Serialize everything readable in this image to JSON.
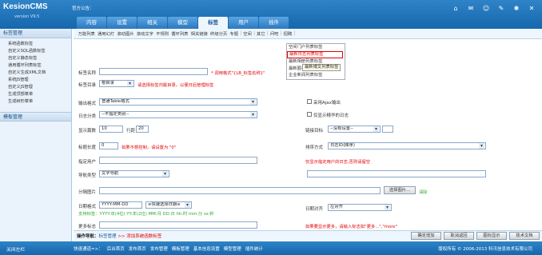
{
  "app": {
    "logo": "KesionCMS",
    "version": "version V9.5",
    "notice": "官方公告："
  },
  "tabs": [
    "内容",
    "设置",
    "相关",
    "模型",
    "标签",
    "用户",
    "插件"
  ],
  "active_tab": "标签",
  "top_icons": [
    "home-icon",
    "mail-icon",
    "user-icon",
    "tools-icon",
    "gear-icon",
    "exit-icon"
  ],
  "subbar": [
    "万能列表",
    "通用幻灯",
    "滚动图片",
    "滚动文字",
    "不规则",
    "循环列表",
    "相关链接",
    "终级分页",
    "专题",
    "│",
    "空间",
    "│",
    "其它",
    "│",
    "问吧",
    "│",
    "招聘",
    "│"
  ],
  "sidebar": {
    "head1": "标签管理",
    "items": [
      "系统函数标签",
      "自定义SQL函数标签",
      "自定义静态标签",
      "通用循环列表标签",
      "自定义生成XML文档",
      "系统JS管理",
      "自定义JS管理",
      "生成顶部菜单",
      "生成树形菜单"
    ],
    "head2": "模板管理"
  },
  "dropdown": {
    "items": [
      "空间门户列表标签",
      "最新日志列表标签",
      "最新相册列表标签",
      "最新圈子列表标签",
      "企业新闻列表标签"
    ],
    "tooltip": "最新博文列表标签"
  },
  "form": {
    "tag_name_label": "标签名称",
    "tag_name_hint": "* 调用格式\"{LB_标签名称}\"",
    "tag_dir_label": "标签目录",
    "tag_dir_value": "根目录",
    "tag_dir_hint": "请选择标签归属目录，以便日后管理标签",
    "output_label": "输出格式",
    "output_value": "普通Table格式",
    "ajax_label": "采用Ajax输出",
    "category_label": "日志分类",
    "category_value": "--不指定类别--",
    "recommend_label": "仅显示精华的日志",
    "count_label": "显示篇数",
    "count_value": "10",
    "cols_label": "行距",
    "cols_value": "20",
    "link_label": "链接目标",
    "link_value": "--没有设置--",
    "title_len_label": "标题长度",
    "title_len_value": "0",
    "title_len_hint": "如果不想控制，请设置为 \"0\"",
    "sort_label": "排序方式",
    "sort_value": "日志ID(降序)",
    "user_label": "指定用户",
    "user_hint": "仅显示指定用户的日志,否则请留空",
    "nav_label": "导航类型",
    "nav_value": "文字导航",
    "divider_label": "分隔图片",
    "select_pic": "选择图片...",
    "clear": "清除",
    "date_label": "日期格式",
    "date_value": "YYYY-MM-DD",
    "date_select": "≡快速选择日期≡",
    "date_hint": "支持标签：YYYY:年(4位) YY:年(2位) MM:月 DD:日 hh:时 mm:分 ss:秒",
    "date_align_label": "日期对齐",
    "date_align_value": "左对齐",
    "more_label": "更多标志",
    "more_hint": "如果要显示更多，请输入标志如\"更多...\",\"more\""
  },
  "actionbar": {
    "breadcrumb_prefix": "操作导航：",
    "breadcrumb_1": "标签管理",
    "breadcrumb_2": " >> 添加系统函数标签",
    "buttons": [
      "确定增加",
      "取消返回",
      "图标显示",
      "技术文档"
    ]
  },
  "status": {
    "close_left": "关闭左栏",
    "quick_prefix": "快速通道=>：",
    "quick_links": [
      "后台首页",
      "发布首页",
      "发布管理",
      "模板管理",
      "基本信息设置",
      "模型管理",
      "插件统计"
    ],
    "copyright": "版权所有 © 2006-2013 科汛信息技术有限公司"
  }
}
